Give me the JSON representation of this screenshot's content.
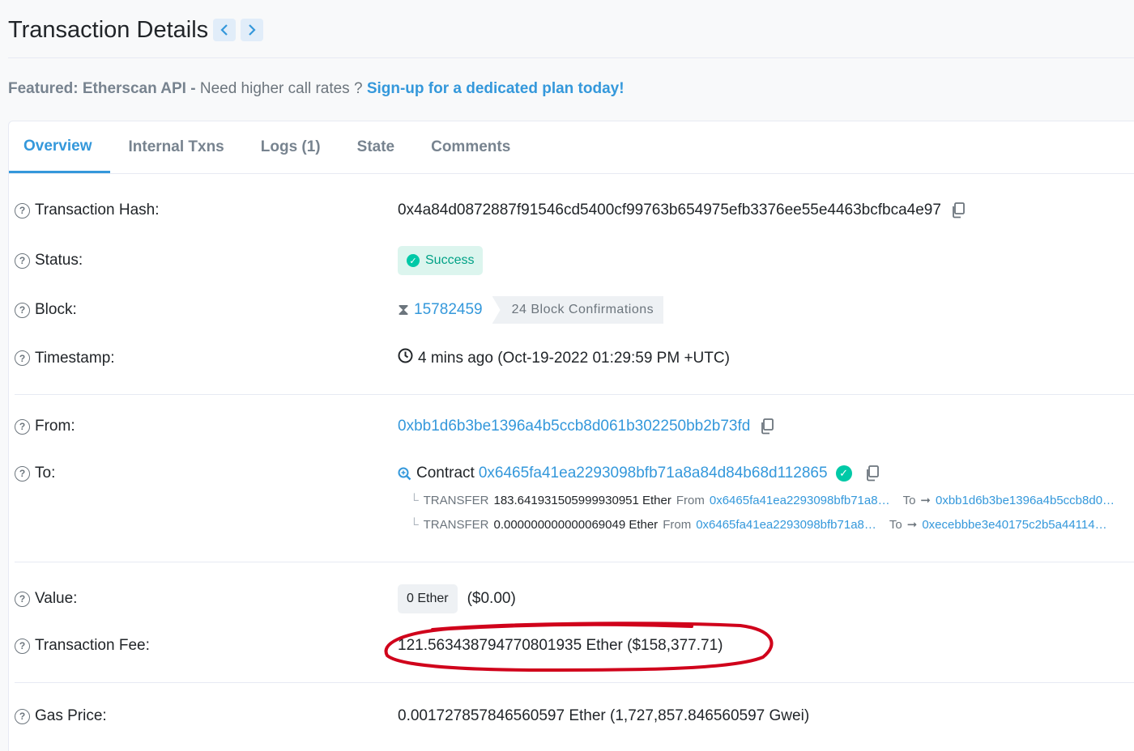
{
  "header": {
    "title": "Transaction Details",
    "prev_icon": "chevron-left-icon",
    "next_icon": "chevron-right-icon"
  },
  "featured": {
    "label": "Featured: Etherscan API -",
    "text": " Need higher call rates ? ",
    "link": "Sign-up for a dedicated plan today!"
  },
  "tabs": [
    {
      "label": "Overview",
      "active": true
    },
    {
      "label": "Internal Txns"
    },
    {
      "label": "Logs (1)"
    },
    {
      "label": "State"
    },
    {
      "label": "Comments"
    }
  ],
  "fields": {
    "hash": {
      "label": "Transaction Hash:",
      "value": "0x4a84d0872887f91546cd5400cf99763b654975efb3376ee55e4463bcfbca4e97"
    },
    "status": {
      "label": "Status:",
      "value": "Success"
    },
    "block": {
      "label": "Block:",
      "value": "15782459",
      "confirmations": "24 Block Confirmations"
    },
    "timestamp": {
      "label": "Timestamp:",
      "value": "4 mins ago (Oct-19-2022 01:29:59 PM +UTC)"
    },
    "from": {
      "label": "From:",
      "value": "0xbb1d6b3be1396a4b5ccb8d061b302250bb2b73fd"
    },
    "to": {
      "label": "To:",
      "prefix": "Contract",
      "value": "0x6465fa41ea2293098bfb71a8a84d84b68d112865",
      "transfers": [
        {
          "type": "TRANSFER",
          "amount": "183.641931505999930951 Ether",
          "from_label": "From",
          "from": "0x6465fa41ea2293098bfb71a8…",
          "to_label": "To",
          "to": "0xbb1d6b3be1396a4b5ccb8d0…"
        },
        {
          "type": "TRANSFER",
          "amount": "0.000000000000069049 Ether",
          "from_label": "From",
          "from": "0x6465fa41ea2293098bfb71a8…",
          "to_label": "To",
          "to": "0xecebbbe3e40175c2b5a44114…"
        }
      ]
    },
    "value": {
      "label": "Value:",
      "ether": "0 Ether",
      "usd": "($0.00)"
    },
    "fee": {
      "label": "Transaction Fee:",
      "value": "121.563438794770801935 Ether ($158,377.71)"
    },
    "gas": {
      "label": "Gas Price:",
      "value": "0.001727857846560597 Ether (1,727,857.846560597 Gwei)"
    }
  },
  "colors": {
    "accent": "#3498db",
    "success": "#00a186",
    "annotation": "#d0021b"
  }
}
